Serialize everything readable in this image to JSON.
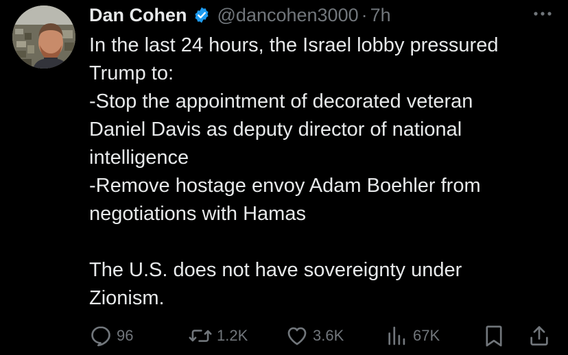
{
  "author": {
    "display_name": "Dan Cohen",
    "handle": "@dancohen3000",
    "separator": "·",
    "time": "7h",
    "verified_icon": "verified-badge-icon",
    "avatar_icon": "avatar-photo"
  },
  "tweet": {
    "lines": [
      "In the last 24 hours, the Israel lobby pressured",
      "Trump to:",
      "-Stop the appointment of decorated veteran",
      "Daniel Davis as deputy director of national",
      "intelligence",
      "-Remove hostage envoy Adam Boehler from",
      "negotiations with Hamas",
      "",
      "The U.S. does not have sovereignty under",
      "Zionism."
    ]
  },
  "actions": {
    "reply": {
      "icon": "reply-icon",
      "count": "96"
    },
    "repost": {
      "icon": "repost-icon",
      "count": "1.2K"
    },
    "like": {
      "icon": "heart-icon",
      "count": "3.6K"
    },
    "views": {
      "icon": "views-icon",
      "count": "67K"
    },
    "bookmark": {
      "icon": "bookmark-icon"
    },
    "share": {
      "icon": "share-icon"
    }
  },
  "colors": {
    "background": "#000000",
    "text": "#e7e9ea",
    "secondary": "#71767b",
    "verified": "#1d9bf0"
  }
}
